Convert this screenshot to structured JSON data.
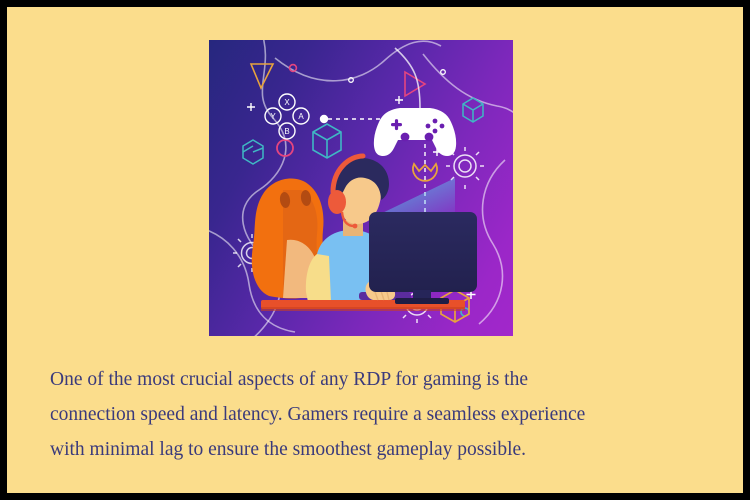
{
  "card": {
    "border_color": "#000000",
    "background_color": "#fbdd8c"
  },
  "illustration": {
    "alt_name": "gamer-at-desk-illustration",
    "background_gradient": [
      "#26277e",
      "#5b28ab",
      "#9b27c8"
    ],
    "colors": {
      "gamepad": "#ffffff",
      "chair": "#f2700f",
      "chair_shade": "#d9601a",
      "hair": "#2b2a5e",
      "headphones": "#ed5a3a",
      "skin": "#f7c98b",
      "shirt": "#79c0f2",
      "sleeves": "#f7dd8a",
      "desk": "#e8502a",
      "monitor": "#262559",
      "beam": "#4ab5e8",
      "accent_orange": "#e8a33d",
      "accent_pink": "#e5457f",
      "accent_teal": "#3fb8c4",
      "accent_white": "#ffffff"
    },
    "elements": [
      {
        "name": "floating-gamepad",
        "label": "gamepad"
      },
      {
        "name": "controller-buttons-cluster",
        "labels": [
          "X",
          "Y",
          "A",
          "B"
        ]
      },
      {
        "name": "gaming-chair",
        "label": "gaming chair"
      },
      {
        "name": "gamer-character",
        "label": "gamer wearing headset"
      },
      {
        "name": "desktop-monitor",
        "label": "monitor"
      },
      {
        "name": "desk-surface",
        "label": "desk"
      },
      {
        "name": "gear-icon",
        "label": "gear"
      },
      {
        "name": "cube-icon",
        "label": "cube"
      },
      {
        "name": "triangle-icon",
        "label": "triangle"
      },
      {
        "name": "sparkle-icon",
        "label": "sparkle"
      },
      {
        "name": "circle-icon",
        "label": "circle"
      },
      {
        "name": "connection-line",
        "label": "dashed connection line"
      }
    ]
  },
  "copy": {
    "text_color": "#3a3a7c",
    "paragraphs": [
      "One of the most crucial aspects of any RDP for gaming is the connection speed and latency. Gamers require a seamless experience",
      "with minimal lag to ensure the smoothest gameplay possible."
    ],
    "line1": "One of the most crucial aspects of any RDP for gaming is the",
    "line2": "connection speed and latency. Gamers require a seamless experience",
    "line3": "with minimal lag to ensure the smoothest gameplay possible."
  }
}
